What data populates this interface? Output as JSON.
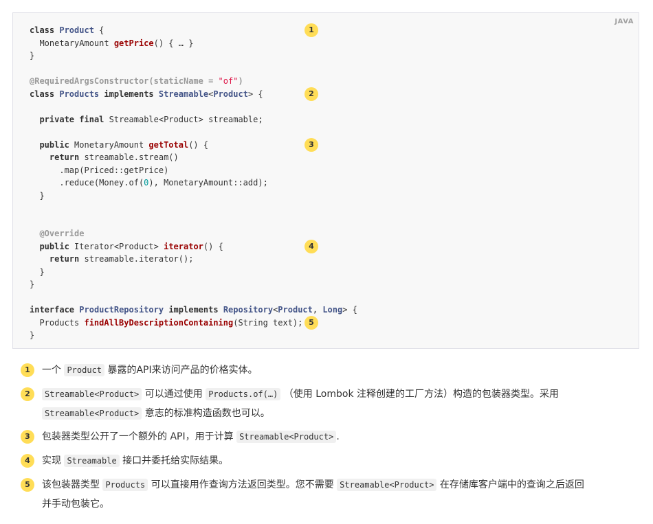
{
  "code": {
    "language": "JAVA",
    "lines": [
      [
        [
          "k",
          "class"
        ],
        [
          "p",
          " "
        ],
        [
          "t",
          "Product"
        ],
        [
          "p",
          " {"
        ]
      ],
      [
        [
          "p",
          "  MonetaryAmount "
        ],
        [
          "f",
          "getPrice"
        ],
        [
          "p",
          "() { … }"
        ]
      ],
      [
        [
          "p",
          "}"
        ]
      ],
      [],
      [
        [
          "a",
          "@RequiredArgsConstructor(staticName = "
        ],
        [
          "s",
          "\"of\""
        ],
        [
          "a",
          ")"
        ]
      ],
      [
        [
          "k",
          "class"
        ],
        [
          "p",
          " "
        ],
        [
          "t",
          "Products"
        ],
        [
          "p",
          " "
        ],
        [
          "k",
          "implements"
        ],
        [
          "p",
          " "
        ],
        [
          "t",
          "Streamable"
        ],
        [
          "p",
          "<"
        ],
        [
          "t",
          "Product"
        ],
        [
          "p",
          "> {"
        ]
      ],
      [],
      [
        [
          "p",
          "  "
        ],
        [
          "k",
          "private"
        ],
        [
          "p",
          " "
        ],
        [
          "k",
          "final"
        ],
        [
          "p",
          " Streamable<Product> streamable;"
        ]
      ],
      [],
      [
        [
          "p",
          "  "
        ],
        [
          "k",
          "public"
        ],
        [
          "p",
          " MonetaryAmount "
        ],
        [
          "f",
          "getTotal"
        ],
        [
          "p",
          "() {"
        ]
      ],
      [
        [
          "p",
          "    "
        ],
        [
          "k",
          "return"
        ],
        [
          "p",
          " streamable.stream()"
        ]
      ],
      [
        [
          "p",
          "      .map(Priced::getPrice)"
        ]
      ],
      [
        [
          "p",
          "      .reduce(Money.of("
        ],
        [
          "n",
          "0"
        ],
        [
          "p",
          "), MonetaryAmount::add);"
        ]
      ],
      [
        [
          "p",
          "  }"
        ]
      ],
      [],
      [],
      [
        [
          "p",
          "  "
        ],
        [
          "a",
          "@Override"
        ]
      ],
      [
        [
          "p",
          "  "
        ],
        [
          "k",
          "public"
        ],
        [
          "p",
          " Iterator<Product> "
        ],
        [
          "f",
          "iterator"
        ],
        [
          "p",
          "() {"
        ]
      ],
      [
        [
          "p",
          "    "
        ],
        [
          "k",
          "return"
        ],
        [
          "p",
          " streamable.iterator();"
        ]
      ],
      [
        [
          "p",
          "  }"
        ]
      ],
      [
        [
          "p",
          "}"
        ]
      ],
      [],
      [
        [
          "k",
          "interface"
        ],
        [
          "p",
          " "
        ],
        [
          "t",
          "ProductRepository"
        ],
        [
          "p",
          " "
        ],
        [
          "k",
          "implements"
        ],
        [
          "p",
          " "
        ],
        [
          "t",
          "Repository"
        ],
        [
          "p",
          "<"
        ],
        [
          "t",
          "Product"
        ],
        [
          "p",
          ", "
        ],
        [
          "t",
          "Long"
        ],
        [
          "p",
          "> {"
        ]
      ],
      [
        [
          "p",
          "  Products "
        ],
        [
          "f",
          "findAllByDescriptionContaining"
        ],
        [
          "p",
          "(String text);"
        ]
      ],
      [
        [
          "p",
          "}"
        ]
      ]
    ],
    "callouts": [
      {
        "num": "1",
        "line": 0
      },
      {
        "num": "2",
        "line": 5
      },
      {
        "num": "3",
        "line": 9
      },
      {
        "num": "4",
        "line": 17
      },
      {
        "num": "5",
        "line": 23
      }
    ]
  },
  "colist": [
    {
      "num": "1",
      "lines": [
        [
          [
            "t",
            "一个 "
          ],
          [
            "c",
            "Product"
          ],
          [
            "t",
            " 暴露的API来访问产品的价格实体。"
          ]
        ]
      ]
    },
    {
      "num": "2",
      "lines": [
        [
          [
            "c",
            "Streamable<Product>"
          ],
          [
            "t",
            " 可以通过使用 "
          ],
          [
            "c",
            "Products.of(…)"
          ],
          [
            "t",
            " （使用 Lombok 注释创建的工厂方法）构造的包装器类型。采用"
          ]
        ],
        [
          [
            "c",
            "Streamable<Product>"
          ],
          [
            "t",
            " 意志的标准构造函数也可以。"
          ]
        ]
      ]
    },
    {
      "num": "3",
      "lines": [
        [
          [
            "t",
            "包装器类型公开了一个额外的 API，用于计算 "
          ],
          [
            "c",
            "Streamable<Product>"
          ],
          [
            "t",
            "."
          ]
        ]
      ]
    },
    {
      "num": "4",
      "lines": [
        [
          [
            "t",
            "实现 "
          ],
          [
            "c",
            "Streamable"
          ],
          [
            "t",
            " 接口并委托给实际结果。"
          ]
        ]
      ]
    },
    {
      "num": "5",
      "lines": [
        [
          [
            "t",
            "该包装器类型 "
          ],
          [
            "c",
            "Products"
          ],
          [
            "t",
            " 可以直接用作查询方法返回类型。您不需要 "
          ],
          [
            "c",
            "Streamable<Product>"
          ],
          [
            "t",
            " 在存储库客户端中的查询之后返回"
          ]
        ],
        [
          [
            "t",
            "并手动包装它。"
          ]
        ]
      ]
    }
  ]
}
